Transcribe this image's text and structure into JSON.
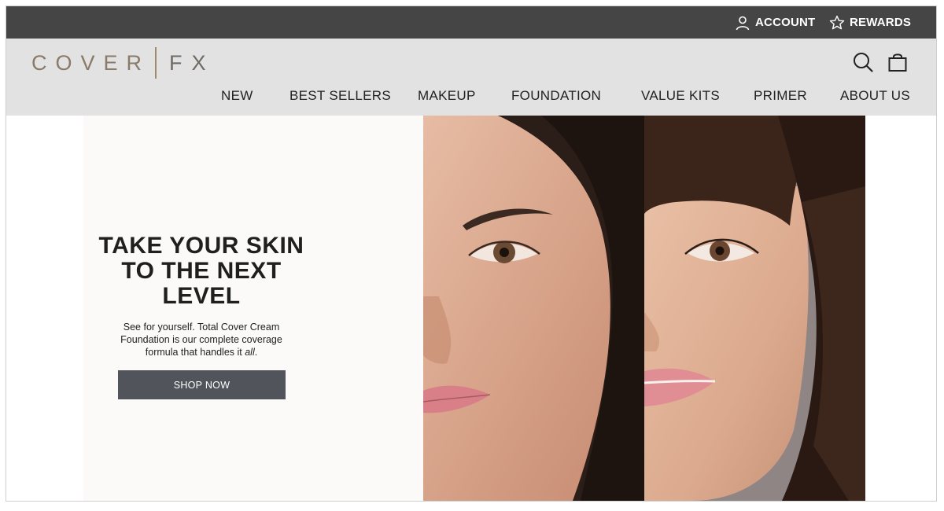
{
  "topbar": {
    "account_label": "ACCOUNT",
    "rewards_label": "REWARDS",
    "account_icon": "user-icon",
    "rewards_icon": "star-icon"
  },
  "header": {
    "logo_left": "COVER",
    "logo_right": "FX",
    "search_icon": "search-icon",
    "bag_icon": "shopping-bag-icon"
  },
  "nav": {
    "items": [
      {
        "label": "NEW"
      },
      {
        "label": "BEST SELLERS"
      },
      {
        "label": "MAKEUP"
      },
      {
        "label": "FOUNDATION"
      },
      {
        "label": "VALUE KITS"
      },
      {
        "label": "PRIMER"
      },
      {
        "label": "ABOUT US"
      }
    ]
  },
  "hero": {
    "headline": "TAKE YOUR SKIN TO THE NEXT LEVEL",
    "subtext_main": "See for yourself. Total Cover Cream Foundation is our complete coverage formula that handles it ",
    "subtext_emphasis": "all",
    "subtext_end": ".",
    "cta_label": "SHOP NOW"
  },
  "colors": {
    "topbar": "#454545",
    "header": "#e2e2e2",
    "button": "#51545a",
    "logo_gold": "#a48a6a"
  }
}
